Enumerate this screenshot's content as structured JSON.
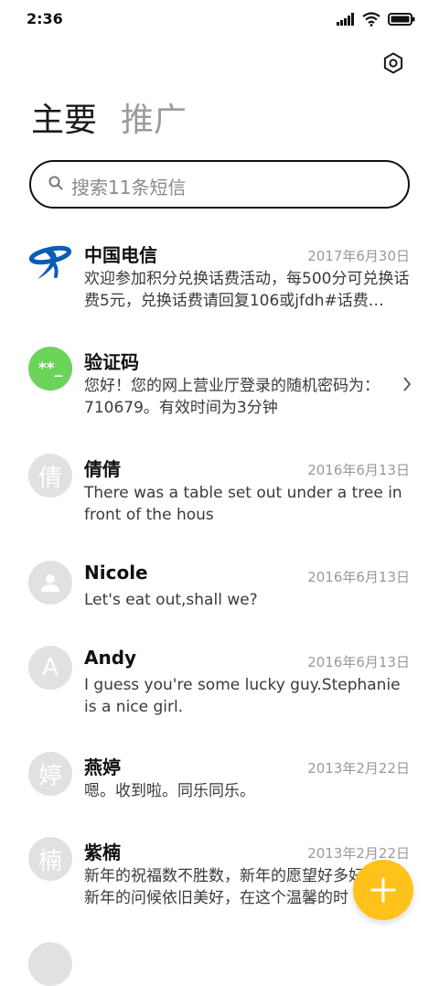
{
  "status_bar": {
    "time": "2:36"
  },
  "tabs": {
    "primary": "主要",
    "promotions": "推广"
  },
  "search": {
    "placeholder": "搜索11条短信"
  },
  "colors": {
    "accent": "#ffc21a",
    "verify_avatar": "#6bd35a",
    "telecom_blue": "#0a5db4",
    "avatar_gray": "#e1e1e1"
  },
  "messages": [
    {
      "name": "中国电信",
      "date": "2017年6月30日",
      "preview": "欢迎参加积分兑换话费活动，每500分可兑换话费5元，兑换话费请回复106或jfdh#话费…",
      "avatar_icon": "china-telecom-logo"
    },
    {
      "name": "验证码",
      "date": "",
      "preview": "您好！您的网上营业厅登录的随机密码为：710679。有效时间为3分钟",
      "avatar_text": "**_"
    },
    {
      "name": "倩倩",
      "date": "2016年6月13日",
      "preview": "There was a table set out under a tree in front of the hous",
      "avatar_text": "倩"
    },
    {
      "name": "Nicole",
      "date": "2016年6月13日",
      "preview": "Let's eat out,shall we?",
      "avatar_icon": "person-icon"
    },
    {
      "name": "Andy",
      "date": "2016年6月13日",
      "preview": "I guess you're some lucky guy.Stephanie is a nice girl.",
      "avatar_text": "A"
    },
    {
      "name": "燕婷",
      "date": "2013年2月22日",
      "preview": "嗯。收到啦。同乐同乐。",
      "avatar_text": "婷"
    },
    {
      "name": "紫楠",
      "date": "2013年2月22日",
      "preview": "新年的祝福数不胜数，新年的愿望好多好多，新年的问候依旧美好，在这个温馨的时",
      "avatar_text": "楠"
    }
  ],
  "partial_item": {
    "avatar_text": ""
  }
}
